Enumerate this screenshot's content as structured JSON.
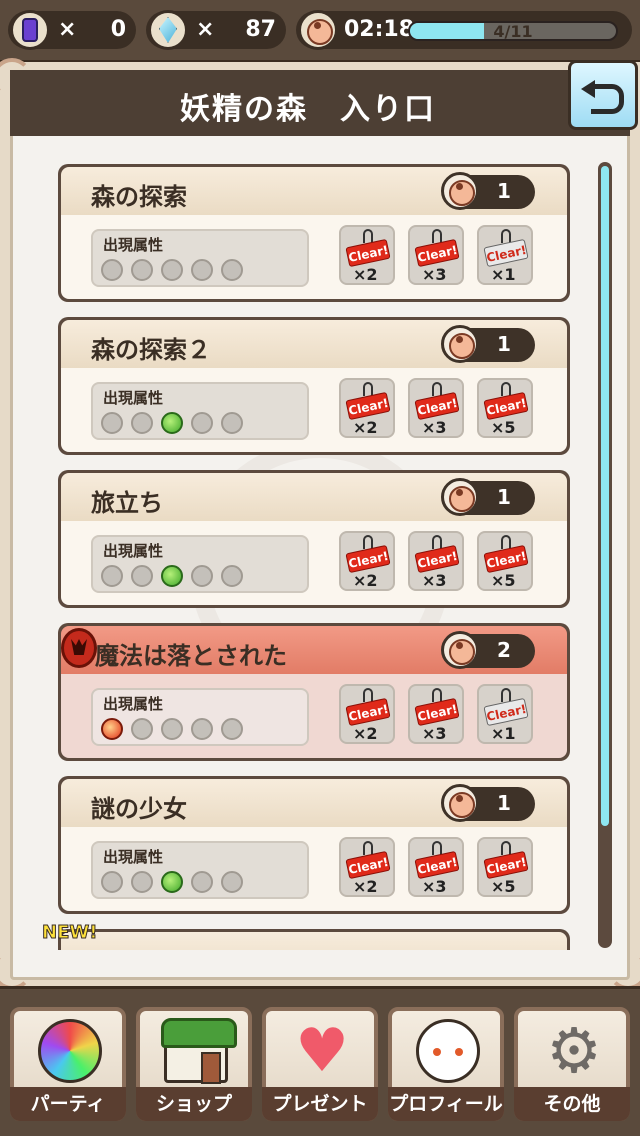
{
  "status": {
    "card_count": "0",
    "crystal_count": "87",
    "times_symbol": "×",
    "stamina_timer": "02:18",
    "stamina_text": "4/11",
    "stamina_fraction": 0.36
  },
  "header": {
    "title": "妖精の森　入り口"
  },
  "quests": [
    {
      "name": "森の探索",
      "cost": "1",
      "attr_label": "出現属性",
      "attrs": [
        "none",
        "none",
        "none",
        "none",
        "none"
      ],
      "badges": [
        {
          "clear": "Clear!",
          "mult": "×2"
        },
        {
          "clear": "Clear!",
          "mult": "×3"
        },
        {
          "clear": "Clear!",
          "mult": "×1"
        }
      ]
    },
    {
      "name": "森の探索２",
      "cost": "1",
      "attr_label": "出現属性",
      "attrs": [
        "none",
        "none",
        "wind",
        "none",
        "none"
      ],
      "badges": [
        {
          "clear": "Clear!",
          "mult": "×2"
        },
        {
          "clear": "Clear!",
          "mult": "×3"
        },
        {
          "clear": "Clear!",
          "mult": "×5"
        }
      ]
    },
    {
      "name": "旅立ち",
      "cost": "1",
      "attr_label": "出現属性",
      "attrs": [
        "none",
        "none",
        "wind",
        "none",
        "none"
      ],
      "badges": [
        {
          "clear": "Clear!",
          "mult": "×2"
        },
        {
          "clear": "Clear!",
          "mult": "×3"
        },
        {
          "clear": "Clear!",
          "mult": "×5"
        }
      ]
    },
    {
      "name": "魔法は落とされた",
      "cost": "2",
      "boss": true,
      "attr_label": "出現属性",
      "attrs": [
        "fire",
        "none",
        "none",
        "none",
        "none"
      ],
      "badges": [
        {
          "clear": "Clear!",
          "mult": "×2"
        },
        {
          "clear": "Clear!",
          "mult": "×3"
        },
        {
          "clear": "Clear!",
          "mult": "×1"
        }
      ]
    },
    {
      "name": "謎の少女",
      "cost": "1",
      "attr_label": "出現属性",
      "attrs": [
        "none",
        "none",
        "wind",
        "none",
        "none"
      ],
      "badges": [
        {
          "clear": "Clear!",
          "mult": "×2"
        },
        {
          "clear": "Clear!",
          "mult": "×3"
        },
        {
          "clear": "Clear!",
          "mult": "×5"
        }
      ]
    }
  ],
  "new_label": "NEW!",
  "nav": {
    "party": "パーティ",
    "shop": "ショップ",
    "present": "プレゼント",
    "profile": "プロフィール",
    "other": "その他"
  },
  "icons": {
    "present": "♥",
    "other": "⚙"
  }
}
